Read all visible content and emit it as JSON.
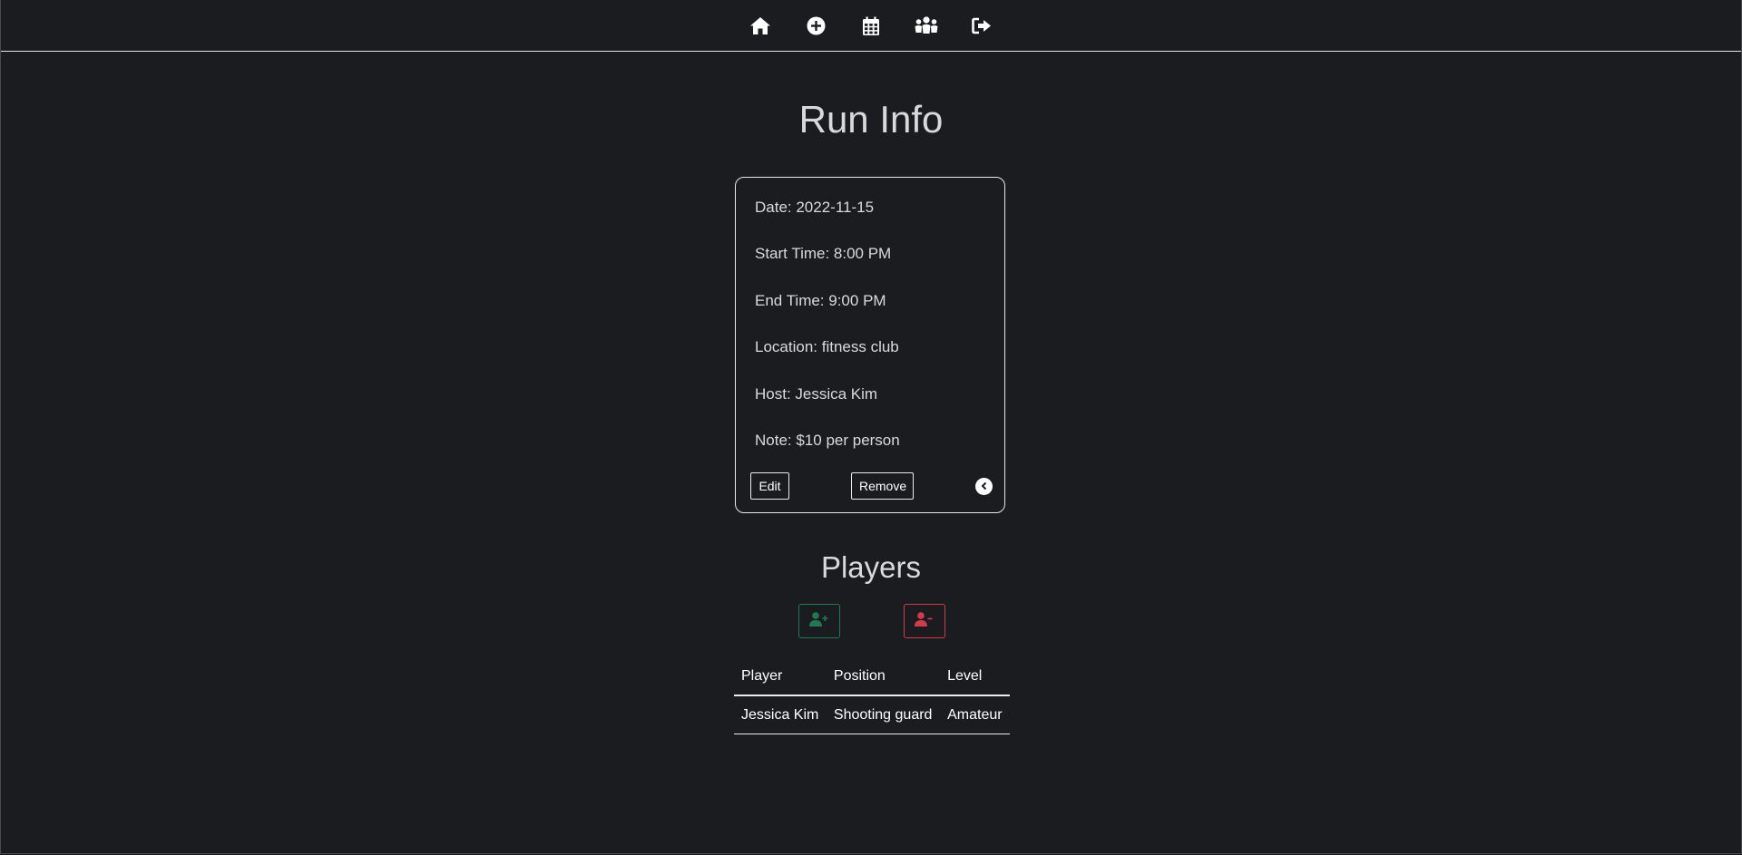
{
  "nav": {
    "items": [
      {
        "icon": "home-icon"
      },
      {
        "icon": "add-circle-icon"
      },
      {
        "icon": "calendar-icon"
      },
      {
        "icon": "users-icon"
      },
      {
        "icon": "sign-out-icon"
      }
    ]
  },
  "page": {
    "title": "Run Info"
  },
  "run": {
    "date": "Date: 2022-11-15",
    "start_time": "Start Time: 8:00 PM",
    "end_time": "End Time: 9:00 PM",
    "location": "Location: fitness club",
    "host": "Host: Jessica Kim",
    "note": "Note: $10 per person",
    "edit_label": "Edit",
    "remove_label": "Remove",
    "back_icon": "chevron-left-circle-icon"
  },
  "players": {
    "title": "Players",
    "add_icon": "user-plus-icon",
    "remove_icon": "user-minus-icon",
    "add_color": "#1f7a4f",
    "remove_color": "#d63a4a",
    "columns": [
      "Player",
      "Position",
      "Level"
    ],
    "rows": [
      [
        "Jessica Kim",
        "Shooting guard",
        "Amateur"
      ]
    ]
  }
}
